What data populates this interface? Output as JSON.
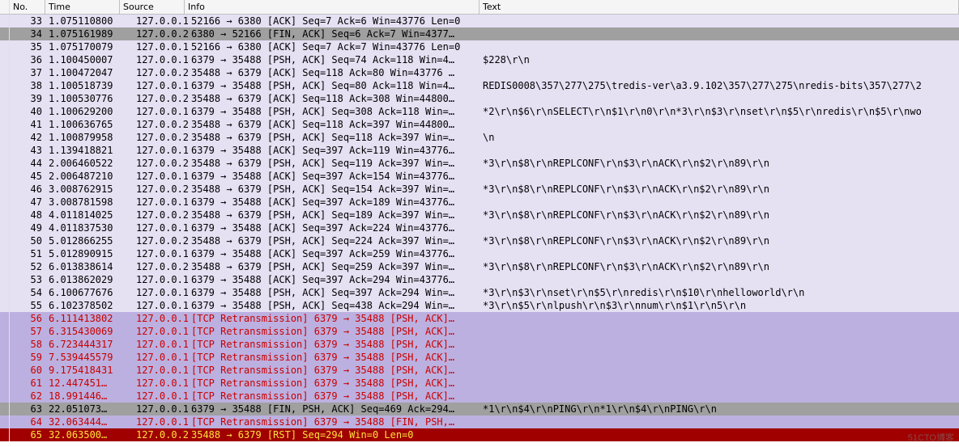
{
  "columns": {
    "no": "No.",
    "time": "Time",
    "source": "Source",
    "info": "Info",
    "text": "Text"
  },
  "rows": [
    {
      "no": "33",
      "time": "1.075110800",
      "src": "127.0.0.1",
      "info": "52166 → 6380 [ACK] Seq=7 Ack=6 Win=43776 Len=0",
      "text": "",
      "style": "lavender"
    },
    {
      "no": "34",
      "time": "1.075161989",
      "src": "127.0.0.2",
      "info": "6380 → 52166 [FIN, ACK] Seq=6 Ack=7 Win=4377…",
      "text": "",
      "style": "grey"
    },
    {
      "no": "35",
      "time": "1.075170079",
      "src": "127.0.0.1",
      "info": "52166 → 6380 [ACK] Seq=7 Ack=7 Win=43776 Len=0",
      "text": "",
      "style": "lavender"
    },
    {
      "no": "36",
      "time": "1.100450007",
      "src": "127.0.0.1",
      "info": "6379 → 35488 [PSH, ACK] Seq=74 Ack=118 Win=4…",
      "text": "$228\\r\\n",
      "style": "lavender"
    },
    {
      "no": "37",
      "time": "1.100472047",
      "src": "127.0.0.2",
      "info": "35488 → 6379 [ACK] Seq=118 Ack=80 Win=43776 …",
      "text": "",
      "style": "lavender"
    },
    {
      "no": "38",
      "time": "1.100518739",
      "src": "127.0.0.1",
      "info": "6379 → 35488 [PSH, ACK] Seq=80 Ack=118 Win=4…",
      "text": "REDIS0008\\357\\277\\275\\tredis-ver\\a3.9.102\\357\\277\\275\\nredis-bits\\357\\277\\2",
      "style": "lavender"
    },
    {
      "no": "39",
      "time": "1.100530776",
      "src": "127.0.0.2",
      "info": "35488 → 6379 [ACK] Seq=118 Ack=308 Win=44800…",
      "text": "",
      "style": "lavender"
    },
    {
      "no": "40",
      "time": "1.100629200",
      "src": "127.0.0.1",
      "info": "6379 → 35488 [PSH, ACK] Seq=308 Ack=118 Win=…",
      "text": "*2\\r\\n$6\\r\\nSELECT\\r\\n$1\\r\\n0\\r\\n*3\\r\\n$3\\r\\nset\\r\\n$5\\r\\nredis\\r\\n$5\\r\\nwo",
      "style": "lavender"
    },
    {
      "no": "41",
      "time": "1.100636765",
      "src": "127.0.0.2",
      "info": "35488 → 6379 [ACK] Seq=118 Ack=397 Win=44800…",
      "text": "",
      "style": "lavender"
    },
    {
      "no": "42",
      "time": "1.100879958",
      "src": "127.0.0.2",
      "info": "35488 → 6379 [PSH, ACK] Seq=118 Ack=397 Win=…",
      "text": "\\n",
      "style": "lavender"
    },
    {
      "no": "43",
      "time": "1.139418821",
      "src": "127.0.0.1",
      "info": "6379 → 35488 [ACK] Seq=397 Ack=119 Win=43776…",
      "text": "",
      "style": "lavender"
    },
    {
      "no": "44",
      "time": "2.006460522",
      "src": "127.0.0.2",
      "info": "35488 → 6379 [PSH, ACK] Seq=119 Ack=397 Win=…",
      "text": "*3\\r\\n$8\\r\\nREPLCONF\\r\\n$3\\r\\nACK\\r\\n$2\\r\\n89\\r\\n",
      "style": "lavender"
    },
    {
      "no": "45",
      "time": "2.006487210",
      "src": "127.0.0.1",
      "info": "6379 → 35488 [ACK] Seq=397 Ack=154 Win=43776…",
      "text": "",
      "style": "lavender"
    },
    {
      "no": "46",
      "time": "3.008762915",
      "src": "127.0.0.2",
      "info": "35488 → 6379 [PSH, ACK] Seq=154 Ack=397 Win=…",
      "text": "*3\\r\\n$8\\r\\nREPLCONF\\r\\n$3\\r\\nACK\\r\\n$2\\r\\n89\\r\\n",
      "style": "lavender"
    },
    {
      "no": "47",
      "time": "3.008781598",
      "src": "127.0.0.1",
      "info": "6379 → 35488 [ACK] Seq=397 Ack=189 Win=43776…",
      "text": "",
      "style": "lavender"
    },
    {
      "no": "48",
      "time": "4.011814025",
      "src": "127.0.0.2",
      "info": "35488 → 6379 [PSH, ACK] Seq=189 Ack=397 Win=…",
      "text": "*3\\r\\n$8\\r\\nREPLCONF\\r\\n$3\\r\\nACK\\r\\n$2\\r\\n89\\r\\n",
      "style": "lavender"
    },
    {
      "no": "49",
      "time": "4.011837530",
      "src": "127.0.0.1",
      "info": "6379 → 35488 [ACK] Seq=397 Ack=224 Win=43776…",
      "text": "",
      "style": "lavender"
    },
    {
      "no": "50",
      "time": "5.012866255",
      "src": "127.0.0.2",
      "info": "35488 → 6379 [PSH, ACK] Seq=224 Ack=397 Win=…",
      "text": "*3\\r\\n$8\\r\\nREPLCONF\\r\\n$3\\r\\nACK\\r\\n$2\\r\\n89\\r\\n",
      "style": "lavender"
    },
    {
      "no": "51",
      "time": "5.012890915",
      "src": "127.0.0.1",
      "info": "6379 → 35488 [ACK] Seq=397 Ack=259 Win=43776…",
      "text": "",
      "style": "lavender"
    },
    {
      "no": "52",
      "time": "6.013838614",
      "src": "127.0.0.2",
      "info": "35488 → 6379 [PSH, ACK] Seq=259 Ack=397 Win=…",
      "text": "*3\\r\\n$8\\r\\nREPLCONF\\r\\n$3\\r\\nACK\\r\\n$2\\r\\n89\\r\\n",
      "style": "lavender"
    },
    {
      "no": "53",
      "time": "6.013862029",
      "src": "127.0.0.1",
      "info": "6379 → 35488 [ACK] Seq=397 Ack=294 Win=43776…",
      "text": "",
      "style": "lavender"
    },
    {
      "no": "54",
      "time": "6.100677676",
      "src": "127.0.0.1",
      "info": "6379 → 35488 [PSH, ACK] Seq=397 Ack=294 Win=…",
      "text": "*3\\r\\n$3\\r\\nset\\r\\n$5\\r\\nredis\\r\\n$10\\r\\nhelloworld\\r\\n",
      "style": "lavender"
    },
    {
      "no": "55",
      "time": "6.102378502",
      "src": "127.0.0.1",
      "info": "6379 → 35488 [PSH, ACK] Seq=438 Ack=294 Win=…",
      "text": "*3\\r\\n$5\\r\\nlpush\\r\\n$3\\r\\nnum\\r\\n$1\\r\\n5\\r\\n",
      "style": "lavender"
    },
    {
      "no": "56",
      "time": "6.111413802",
      "src": "127.0.0.1",
      "info": "[TCP Retransmission] 6379 → 35488 [PSH, ACK]…",
      "text": "",
      "style": "purple-red"
    },
    {
      "no": "57",
      "time": "6.315430069",
      "src": "127.0.0.1",
      "info": "[TCP Retransmission] 6379 → 35488 [PSH, ACK]…",
      "text": "",
      "style": "purple-red"
    },
    {
      "no": "58",
      "time": "6.723444317",
      "src": "127.0.0.1",
      "info": "[TCP Retransmission] 6379 → 35488 [PSH, ACK]…",
      "text": "",
      "style": "purple-red"
    },
    {
      "no": "59",
      "time": "7.539445579",
      "src": "127.0.0.1",
      "info": "[TCP Retransmission] 6379 → 35488 [PSH, ACK]…",
      "text": "",
      "style": "purple-red"
    },
    {
      "no": "60",
      "time": "9.175418431",
      "src": "127.0.0.1",
      "info": "[TCP Retransmission] 6379 → 35488 [PSH, ACK]…",
      "text": "",
      "style": "purple-red"
    },
    {
      "no": "61",
      "time": "12.447451…",
      "src": "127.0.0.1",
      "info": "[TCP Retransmission] 6379 → 35488 [PSH, ACK]…",
      "text": "",
      "style": "purple-red"
    },
    {
      "no": "62",
      "time": "18.991446…",
      "src": "127.0.0.1",
      "info": "[TCP Retransmission] 6379 → 35488 [PSH, ACK]…",
      "text": "",
      "style": "purple-red"
    },
    {
      "no": "63",
      "time": "22.051073…",
      "src": "127.0.0.1",
      "info": "6379 → 35488 [FIN, PSH, ACK] Seq=469 Ack=294…",
      "text": "*1\\r\\n$4\\r\\nPING\\r\\n*1\\r\\n$4\\r\\nPING\\r\\n",
      "style": "grey"
    },
    {
      "no": "64",
      "time": "32.063444…",
      "src": "127.0.0.1",
      "info": "[TCP Retransmission] 6379 → 35488 [FIN, PSH,…",
      "text": "",
      "style": "purple-red"
    },
    {
      "no": "65",
      "time": "32.063500…",
      "src": "127.0.0.2",
      "info": "35488 → 6379 [RST] Seq=294 Win=0 Len=0",
      "text": "",
      "style": "red-yellow"
    }
  ],
  "watermark": "51CTO博客"
}
